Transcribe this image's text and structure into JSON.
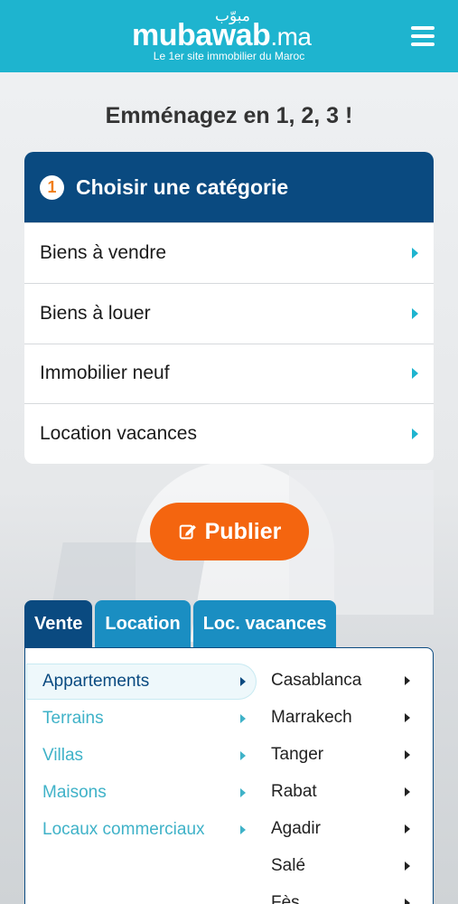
{
  "header": {
    "logo_arabic": "مبوّب",
    "logo_name": "mubawab",
    "logo_tld": ".ma",
    "tagline": "Le 1er site immobilier du Maroc",
    "menu_icon": "hamburger-icon",
    "bg_color": "#1eb4cf"
  },
  "headline": "Emménagez en 1, 2, 3 !",
  "category_card": {
    "step_number": "1",
    "title": "Choisir une catégorie",
    "items": [
      {
        "label": "Biens à vendre"
      },
      {
        "label": "Biens à louer"
      },
      {
        "label": "Immobilier neuf"
      },
      {
        "label": "Location vacances"
      }
    ]
  },
  "publish": {
    "label": "Publier",
    "icon": "edit-icon",
    "color": "#f4650f"
  },
  "tabs": [
    {
      "label": "Vente",
      "active": true
    },
    {
      "label": "Location",
      "active": false
    },
    {
      "label": "Loc. vacances",
      "active": false
    }
  ],
  "property_types": [
    {
      "label": "Appartements",
      "active": true
    },
    {
      "label": "Terrains",
      "active": false
    },
    {
      "label": "Villas",
      "active": false
    },
    {
      "label": "Maisons",
      "active": false
    },
    {
      "label": "Locaux commerciaux",
      "active": false
    }
  ],
  "cities": [
    {
      "label": "Casablanca"
    },
    {
      "label": "Marrakech"
    },
    {
      "label": "Tanger"
    },
    {
      "label": "Rabat"
    },
    {
      "label": "Agadir"
    },
    {
      "label": "Salé"
    },
    {
      "label": "Fès"
    }
  ],
  "colors": {
    "navy": "#0a4a80",
    "teal": "#1eb4cf",
    "orange": "#f4650f"
  }
}
